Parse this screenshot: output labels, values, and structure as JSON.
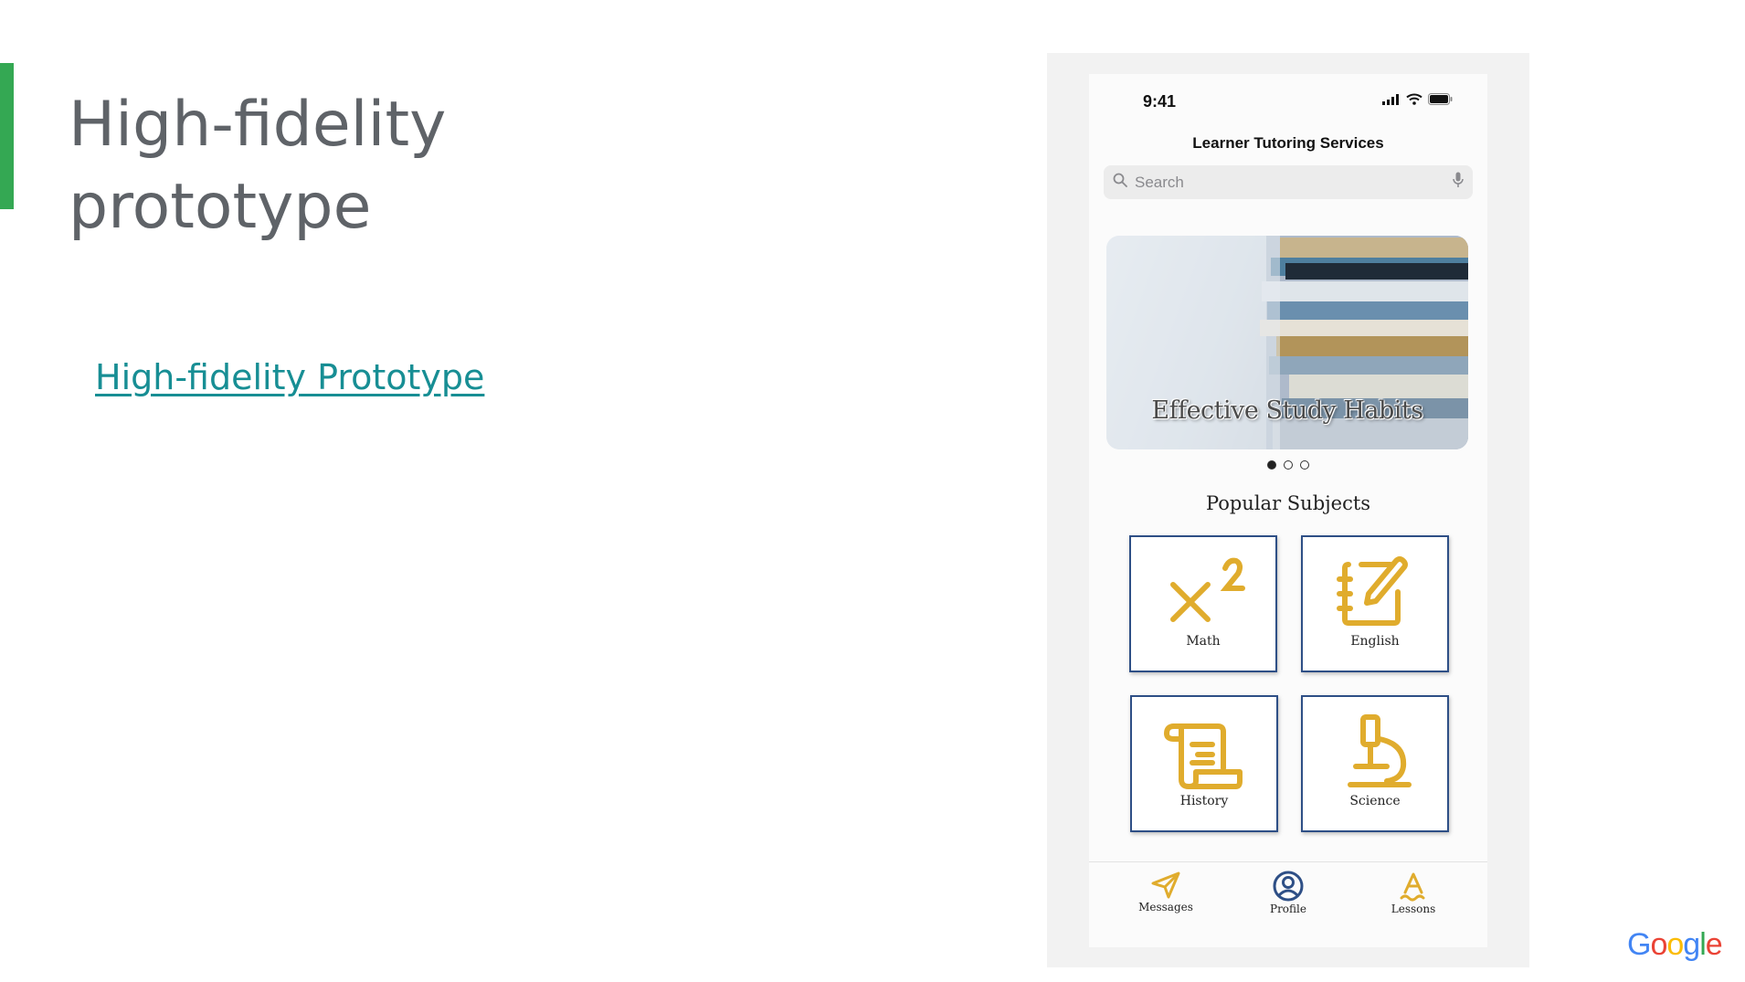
{
  "slide": {
    "title": "High-fidelity prototype",
    "link_text": "High-fidelity Prototype",
    "accent_color": "#34a853",
    "link_color": "#178e94"
  },
  "phone": {
    "status_time": "9:41",
    "app_title": "Learner Tutoring Services",
    "search_placeholder": "Search",
    "banner_text": "Effective Study Habits",
    "carousel_total": 3,
    "carousel_active": 1,
    "section_title": "Popular Subjects",
    "subjects": [
      {
        "label": "Math",
        "icon": "superscript-x-icon"
      },
      {
        "label": "English",
        "icon": "notebook-pen-icon"
      },
      {
        "label": "History",
        "icon": "scroll-icon"
      },
      {
        "label": "Science",
        "icon": "microscope-icon"
      }
    ],
    "tabs": [
      {
        "label": "Messages",
        "icon": "paper-plane-icon"
      },
      {
        "label": "Profile",
        "icon": "user-circle-icon"
      },
      {
        "label": "Lessons",
        "icon": "lessons-icon"
      }
    ],
    "icon_color": "#e0ac2d",
    "card_border_color": "#2e4f86"
  },
  "branding": {
    "logo_text": "Google",
    "letters": [
      {
        "char": "G",
        "color": "#4285f4"
      },
      {
        "char": "o",
        "color": "#ea4335"
      },
      {
        "char": "o",
        "color": "#fbbc05"
      },
      {
        "char": "g",
        "color": "#4285f4"
      },
      {
        "char": "l",
        "color": "#34a853"
      },
      {
        "char": "e",
        "color": "#ea4335"
      }
    ]
  }
}
